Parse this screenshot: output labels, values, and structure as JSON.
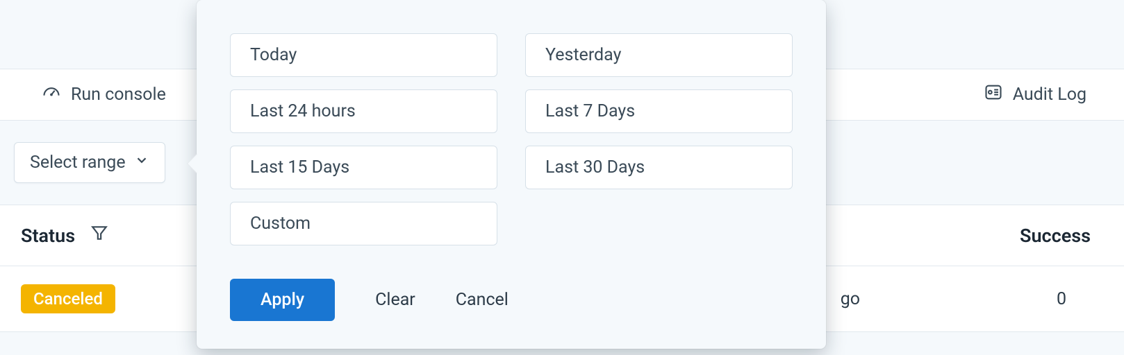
{
  "tabs": {
    "run_console": "Run console",
    "audit_log": "Audit Log"
  },
  "filter": {
    "select_range_label": "Select range"
  },
  "table": {
    "headers": {
      "status": "Status",
      "success": "Success"
    },
    "rows": [
      {
        "status_badge": "Canceled",
        "time_fragment": "go",
        "success": "0"
      }
    ]
  },
  "range_popover": {
    "options": [
      "Today",
      "Yesterday",
      "Last 24 hours",
      "Last 7 Days",
      "Last 15 Days",
      "Last 30 Days",
      "Custom"
    ],
    "actions": {
      "apply": "Apply",
      "clear": "Clear",
      "cancel": "Cancel"
    }
  }
}
